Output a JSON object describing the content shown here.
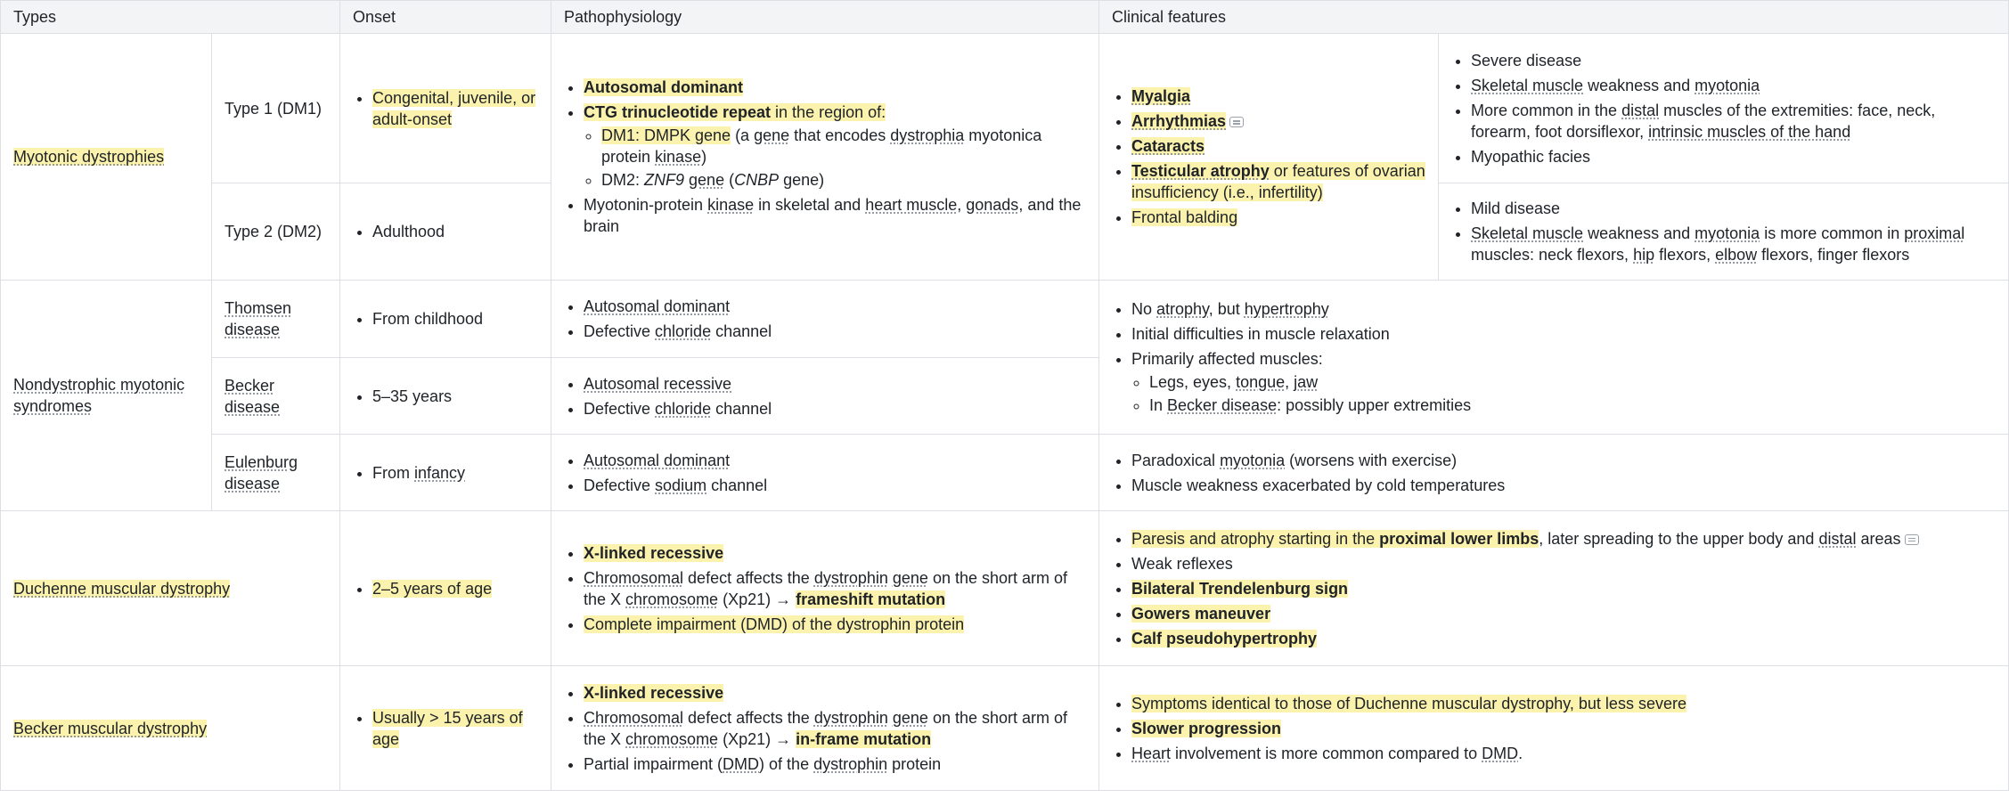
{
  "headers": {
    "types": "Types",
    "onset": "Onset",
    "pathophysiology": "Pathophysiology",
    "clinical": "Clinical features"
  },
  "myotonic": {
    "group": "Myotonic dystrophies",
    "dm1_label": "Type 1 (DM1)",
    "dm2_label": "Type 2 (DM2)",
    "dm1_onset": "Congenital, juvenile, or adult-onset",
    "dm2_onset": "Adulthood",
    "patho": {
      "inheritance": "Autosomal dominant",
      "ctg_bold": "CTG trinucleotide repeat",
      "ctg_rest": " in the region of:",
      "dm1_hl": "DM1: DMPK gene",
      "dm1_rest_a": " (a ",
      "dm1_gene": "gene",
      "dm1_rest_b": " that encodes ",
      "dm1_dystro": "dystrophia",
      "dm1_rest_c": " myotonica protein ",
      "dm1_kinase": "kinase",
      "dm1_rest_d": ")",
      "dm2_a": "DM2: ",
      "dm2_znf": "ZNF9",
      "dm2_b": " ",
      "dm2_gene": "gene",
      "dm2_c": " (",
      "dm2_cnbp": "CNBP",
      "dm2_d": " gene)",
      "mpk_a": "Myotonin-protein ",
      "mpk_kinase": "kinase",
      "mpk_b": " in skeletal and ",
      "mpk_heart": "heart muscle",
      "mpk_c": ", ",
      "mpk_gonads": "gonads",
      "mpk_d": ", and the brain"
    },
    "shared_features": {
      "myalgia": "Myalgia",
      "arrhythmias": "Arrhythmias",
      "cataracts": "Cataracts",
      "testicular_bold": "Testicular atrophy",
      "testicular_rest": " or features of ovarian insufficiency (i.e., infertility)",
      "frontal": "Frontal balding"
    },
    "dm1_features": {
      "severe": "Severe disease",
      "weak_a": "Skeletal muscle",
      "weak_b": " weakness and ",
      "weak_c": "myotonia",
      "distal_a": "More common in the ",
      "distal_b": "distal",
      "distal_c": " muscles of the extremities: face, neck, forearm, foot dorsiflexor, ",
      "distal_d": "intrinsic muscles of the hand",
      "facies": "Myopathic facies"
    },
    "dm2_features": {
      "mild": "Mild disease",
      "weak_a": "Skeletal muscle",
      "weak_b": " weakness and ",
      "weak_c": "myotonia",
      "weak_d": " is more common in ",
      "weak_e": "proximal",
      "weak_f": " muscles: neck flexors, ",
      "weak_g": "hip",
      "weak_h": " flexors, ",
      "weak_i": "elbow",
      "weak_j": " flexors, finger flexors"
    }
  },
  "nondystrophic": {
    "group": "Nondystrophic myotonic syndromes",
    "thomsen_label": "Thomsen disease",
    "thomsen_onset": "From childhood",
    "thomsen_patho1": "Autosomal dominant",
    "thomsen_patho2_a": "Defective ",
    "thomsen_patho2_b": "chloride",
    "thomsen_patho2_c": " channel",
    "becker_label": "Becker disease",
    "becker_onset": "5–35 years",
    "becker_patho1": "Autosomal recessive",
    "becker_patho2_a": "Defective ",
    "becker_patho2_b": "chloride",
    "becker_patho2_c": " channel",
    "shared_features": {
      "atrophy_a": "No ",
      "atrophy_b": "atrophy",
      "atrophy_c": ", but ",
      "atrophy_d": "hypertrophy",
      "initial": "Initial difficulties in muscle relaxation",
      "primarily": "Primarily affected muscles:",
      "legs_a": "Legs, eyes, ",
      "legs_b": "tongue",
      "legs_c": ", ",
      "legs_d": "jaw",
      "becker_a": "In ",
      "becker_b": "Becker disease",
      "becker_c": ": possibly upper extremities"
    },
    "eulenburg_label": "Eulenburg disease",
    "eulenburg_onset_a": "From ",
    "eulenburg_onset_b": "infancy",
    "eulenburg_patho1": "Autosomal dominant",
    "eulenburg_patho2_a": "Defective ",
    "eulenburg_patho2_b": "sodium",
    "eulenburg_patho2_c": " channel",
    "eulenburg_features": {
      "para_a": "Paradoxical ",
      "para_b": "myotonia",
      "para_c": " (worsens with exercise)",
      "cold": "Muscle weakness exacerbated by cold temperatures"
    }
  },
  "duchenne": {
    "label": "Duchenne muscular dystrophy",
    "onset": "2–5 years of age",
    "patho": {
      "xlinked": "X-linked recessive",
      "chrom_a": "Chromosomal",
      "chrom_b": " defect affects the ",
      "chrom_c": "dystrophin",
      "chrom_d": " ",
      "chrom_e": "gene",
      "chrom_f": " on the short arm of the X ",
      "chrom_g": "chromosome",
      "chrom_h": " (Xp21) → ",
      "chrom_i": "frameshift mutation",
      "complete": "Complete impairment (DMD) of the dystrophin protein"
    },
    "features": {
      "paresis_a": "Paresis and atrophy starting in the ",
      "paresis_b": "proximal lower limbs",
      "paresis_c": ", later spreading to the upper body and ",
      "paresis_d": "distal",
      "paresis_e": " areas",
      "reflexes": "Weak reflexes",
      "trendelenburg": "Bilateral Trendelenburg sign",
      "gowers": "Gowers maneuver",
      "calf": "Calf pseudohypertrophy"
    }
  },
  "becker_md": {
    "label": "Becker muscular dystrophy",
    "onset": "Usually > 15 years of age",
    "patho": {
      "xlinked": "X-linked recessive",
      "chrom_a": "Chromosomal",
      "chrom_b": " defect affects the ",
      "chrom_c": "dystrophin",
      "chrom_d": " ",
      "chrom_e": "gene",
      "chrom_f": " on the short arm of the X ",
      "chrom_g": "chromosome",
      "chrom_h": " (Xp21) → ",
      "chrom_i": "in-frame mutation",
      "partial_a": "Partial impairment (",
      "partial_b": "DMD",
      "partial_c": ") of the ",
      "partial_d": "dystrophin",
      "partial_e": " protein"
    },
    "features": {
      "symptoms": "Symptoms identical to those of Duchenne muscular dystrophy, but less severe",
      "slower": "Slower progression",
      "heart_a": "Heart",
      "heart_b": " involvement is more common compared to ",
      "heart_c": "DMD",
      "heart_d": "."
    }
  }
}
